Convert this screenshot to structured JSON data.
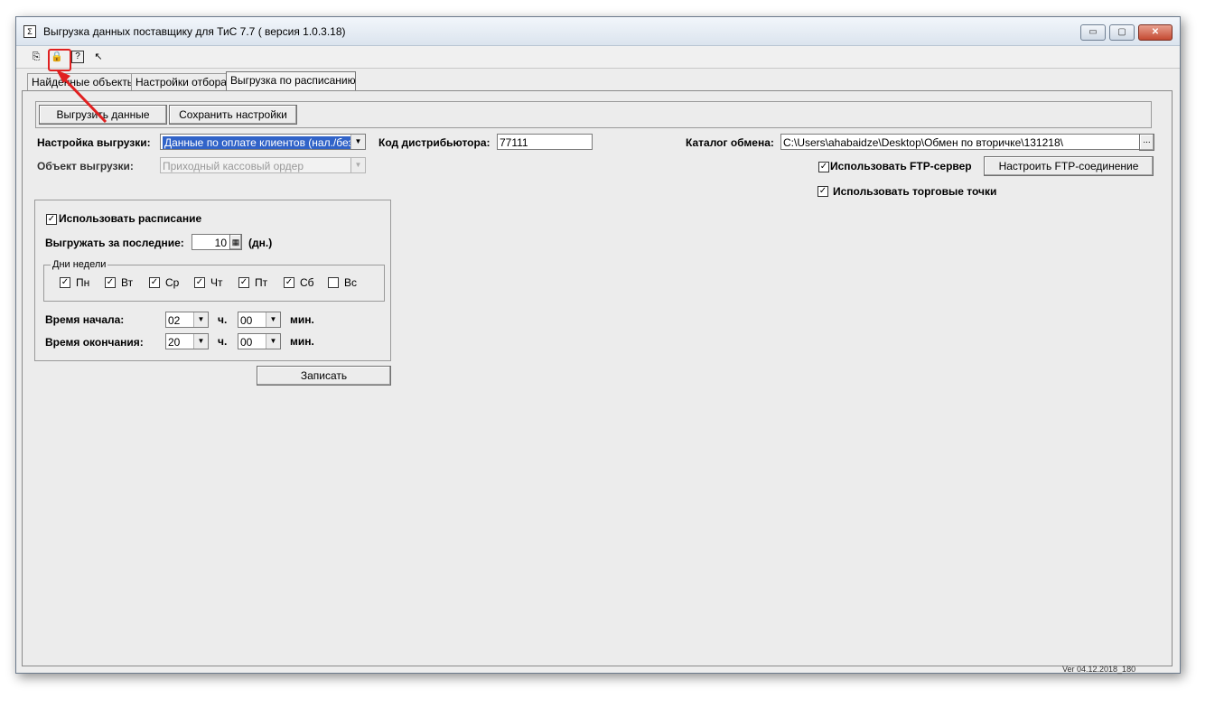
{
  "window": {
    "title": "Выгрузка данных поставщику для ТиС 7.7 ( версия 1.0.3.18)",
    "minimize": "▭",
    "maximize": "▢",
    "close": "✕"
  },
  "toolbar": {
    "icons": [
      "upload-icon",
      "lock-upload-icon",
      "help-icon",
      "pointer-help-icon"
    ]
  },
  "tabs": [
    {
      "label": "Найденные объекты"
    },
    {
      "label": "Настройки отбора"
    },
    {
      "label": "Выгрузка по расписанию"
    }
  ],
  "actions": {
    "export_label": "Выгрузить данные",
    "save_label": "Сохранить настройки"
  },
  "settings": {
    "export_setting_label": "Настройка выгрузки:",
    "export_setting_value": "Данные по оплате клиентов (нал./безнал)",
    "export_object_label": "Объект выгрузки:",
    "export_object_value": "Приходный кассовый ордер",
    "distributor_code_label": "Код дистрибьютора:",
    "distributor_code_value": "77111",
    "catalog_label": "Каталог обмена:",
    "catalog_value": "C:\\Users\\ahabaidze\\Desktop\\Обмен по вторичке\\131218\\",
    "catalog_browse": "...",
    "use_ftp_label": "Использовать FTP-сервер",
    "ftp_config_label": "Настроить FTP-соединение",
    "use_outlets_label": "Использовать торговые точки"
  },
  "schedule": {
    "use_schedule_label": "Использовать расписание",
    "last_days_label": "Выгружать за последние:",
    "last_days_value": "10",
    "days_unit": "(дн.)",
    "weekdays_group_label": "Дни недели",
    "weekdays": [
      {
        "label": "Пн",
        "checked": true
      },
      {
        "label": "Вт",
        "checked": true
      },
      {
        "label": "Ср",
        "checked": true
      },
      {
        "label": "Чт",
        "checked": true
      },
      {
        "label": "Пт",
        "checked": true
      },
      {
        "label": "Сб",
        "checked": true
      },
      {
        "label": "Вс",
        "checked": false
      }
    ],
    "start_label": "Время начала:",
    "start_hours": "02",
    "start_minutes": "00",
    "end_label": "Время окончания:",
    "end_hours": "20",
    "end_minutes": "00",
    "hours_unit": "ч.",
    "minutes_unit": "мин.",
    "write_label": "Записать"
  },
  "status": {
    "version": "Ver 04.12.2018_180"
  },
  "colors": {
    "highlight": "#e02020",
    "selection": "#3163c8"
  }
}
